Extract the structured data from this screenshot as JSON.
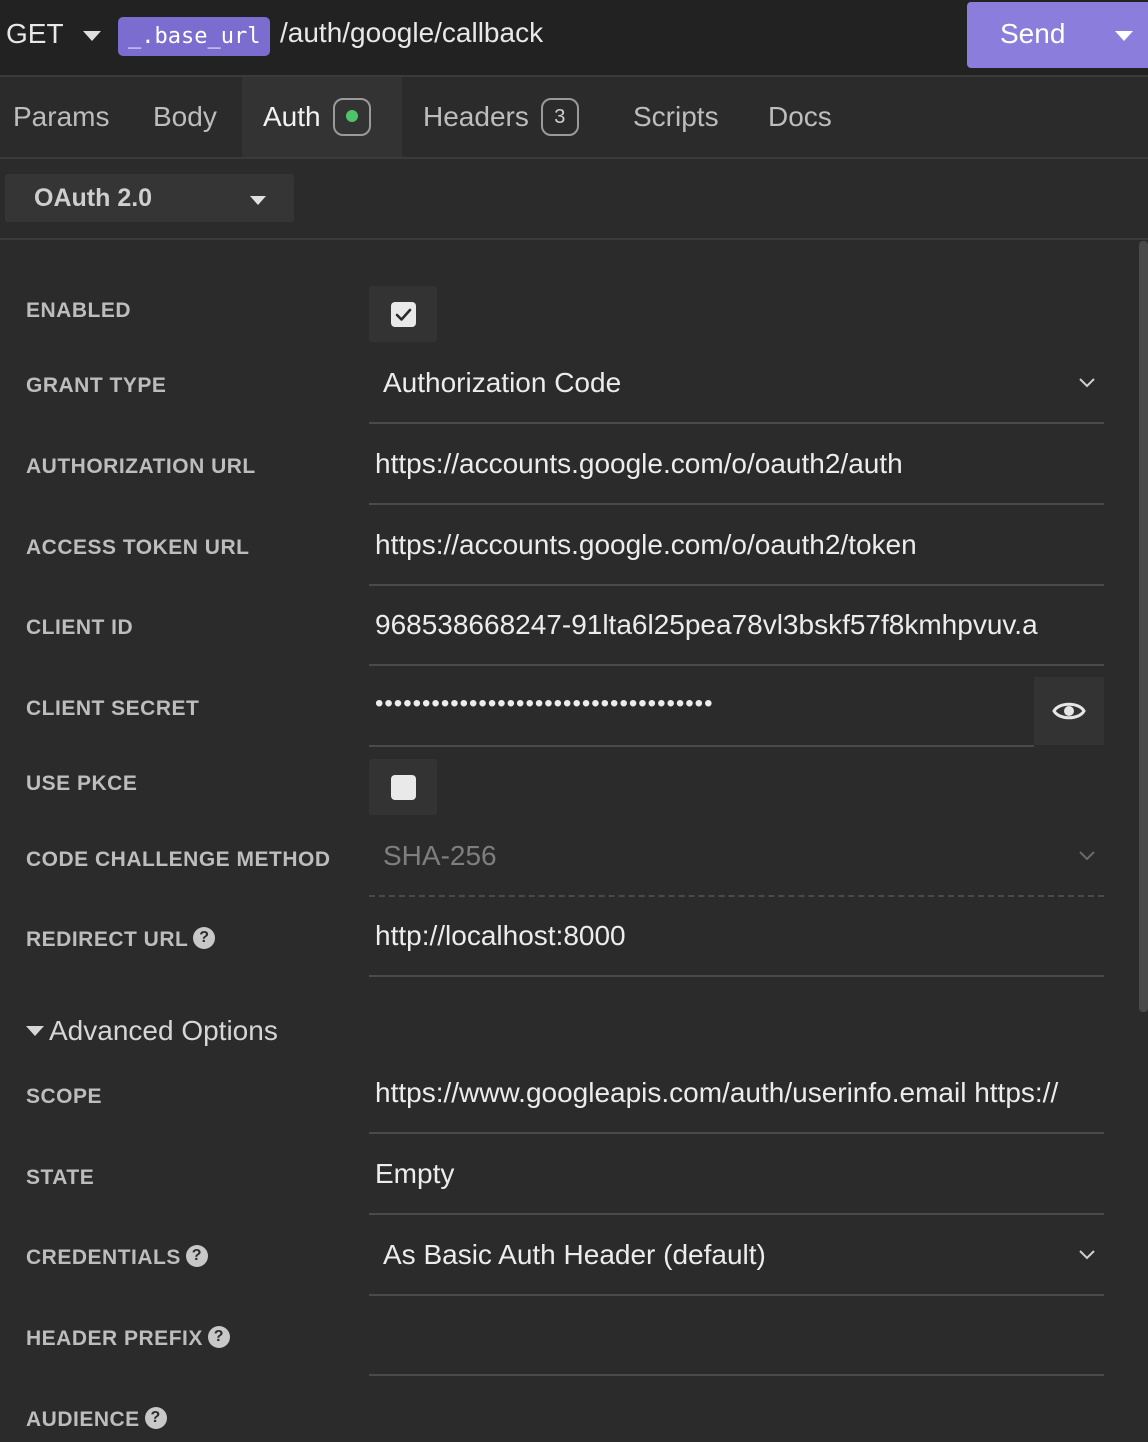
{
  "request": {
    "method": "GET",
    "url_variable": "_.base_url",
    "url_path": "/auth/google/callback",
    "send_label": "Send"
  },
  "tabs": [
    {
      "label": "Params",
      "badge": null
    },
    {
      "label": "Body",
      "badge": null
    },
    {
      "label": "Auth",
      "badge": "active-dot"
    },
    {
      "label": "Headers",
      "badge": "3"
    },
    {
      "label": "Scripts",
      "badge": null
    },
    {
      "label": "Docs",
      "badge": null
    }
  ],
  "auth_type": "OAuth 2.0",
  "form": {
    "enabled": {
      "label": "ENABLED",
      "checked": true
    },
    "grant_type": {
      "label": "GRANT TYPE",
      "value": "Authorization Code"
    },
    "authorization_url": {
      "label": "AUTHORIZATION URL",
      "value": "https://accounts.google.com/o/oauth2/auth"
    },
    "access_token_url": {
      "label": "ACCESS TOKEN URL",
      "value": "https://accounts.google.com/o/oauth2/token"
    },
    "client_id": {
      "label": "CLIENT ID",
      "value": "968538668247-91lta6l25pea78vl3bskf57f8kmhpvuv.a"
    },
    "client_secret": {
      "label": "CLIENT SECRET",
      "value": "••••••••••••••••••••••••••••••••••••"
    },
    "use_pkce": {
      "label": "USE PKCE",
      "checked": false
    },
    "code_challenge_method": {
      "label": "CODE CHALLENGE METHOD",
      "value": "SHA-256"
    },
    "redirect_url": {
      "label": "REDIRECT URL",
      "value": "http://localhost:8000"
    },
    "advanced_options": {
      "label": "Advanced Options"
    },
    "scope": {
      "label": "SCOPE",
      "value": "https://www.googleapis.com/auth/userinfo.email https://"
    },
    "state": {
      "label": "STATE",
      "value": "Empty"
    },
    "credentials": {
      "label": "CREDENTIALS",
      "value": "As Basic Auth Header (default)"
    },
    "header_prefix": {
      "label": "HEADER PREFIX",
      "value": ""
    },
    "audience": {
      "label": "AUDIENCE",
      "value": ""
    }
  },
  "help_glyph": "?",
  "colors": {
    "accent": "#8b7ddb",
    "url_variable_bg": "#7b6ccf",
    "active_indicator": "#4ec46a",
    "background": "#2b2b2b"
  },
  "icons": {
    "method_dropdown": "caret-down-icon",
    "send_dropdown": "caret-down-icon",
    "checkbox_checked": "checkmark-icon",
    "select_chevron": "chevron-down-icon",
    "reveal_secret": "eye-icon",
    "help": "question-circle-icon"
  }
}
